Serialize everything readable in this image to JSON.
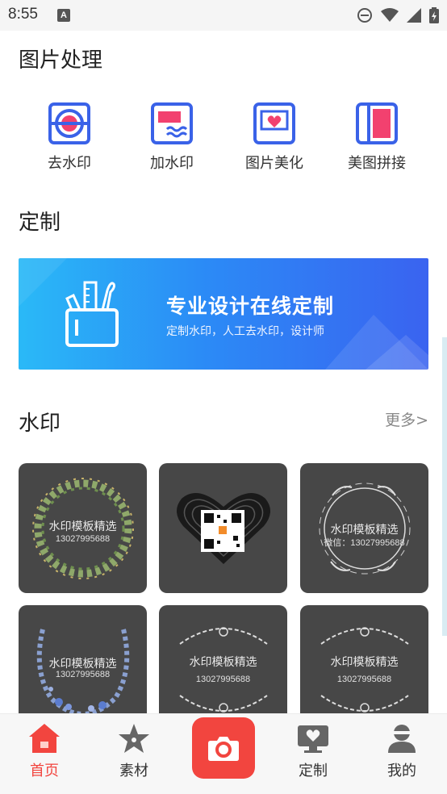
{
  "status_bar": {
    "time": "8:55",
    "notification_icon": "A",
    "icons": [
      "do-not-disturb-icon",
      "wifi-icon",
      "cell-signal-icon",
      "battery-charging-icon"
    ]
  },
  "sections": {
    "image_processing": "图片处理",
    "custom": "定制",
    "watermark": "水印",
    "more": "更多>"
  },
  "tools": [
    {
      "label": "去水印",
      "icon": "remove-watermark-icon"
    },
    {
      "label": "加水印",
      "icon": "add-watermark-icon"
    },
    {
      "label": "图片美化",
      "icon": "beautify-icon"
    },
    {
      "label": "美图拼接",
      "icon": "collage-icon"
    }
  ],
  "banner": {
    "title": "专业设计在线定制",
    "subtitle": "定制水印，人工去水印，设计师",
    "icon": "design-tools-icon"
  },
  "watermark_cards": [
    {
      "text": "水印模板精选",
      "phone": "13027995688",
      "style": "leaf-wreath"
    },
    {
      "text": "",
      "phone": "",
      "style": "fingerprint-heart-qr"
    },
    {
      "text": "水印模板精选",
      "phone": "微信：13027995688",
      "style": "floral-circle"
    },
    {
      "text": "水印模板精选",
      "phone": "13027995688",
      "style": "laurel-blue"
    },
    {
      "text": "水印模板精选",
      "phone": "13027995688",
      "style": "flower-lines"
    },
    {
      "text": "水印模板精选",
      "phone": "13027995688",
      "style": "flower-lines"
    }
  ],
  "bottom_nav": [
    {
      "label": "首页",
      "icon": "home-icon",
      "active": true
    },
    {
      "label": "素材",
      "icon": "star-icon",
      "active": false
    },
    {
      "label": "",
      "icon": "camera-icon",
      "active": false
    },
    {
      "label": "定制",
      "icon": "monitor-heart-icon",
      "active": false
    },
    {
      "label": "我的",
      "icon": "user-icon",
      "active": false
    }
  ],
  "colors": {
    "accent": "#f2453f",
    "tool_blue": "#3a62e8",
    "tool_pink": "#f2416f",
    "card_bg": "#474747"
  }
}
